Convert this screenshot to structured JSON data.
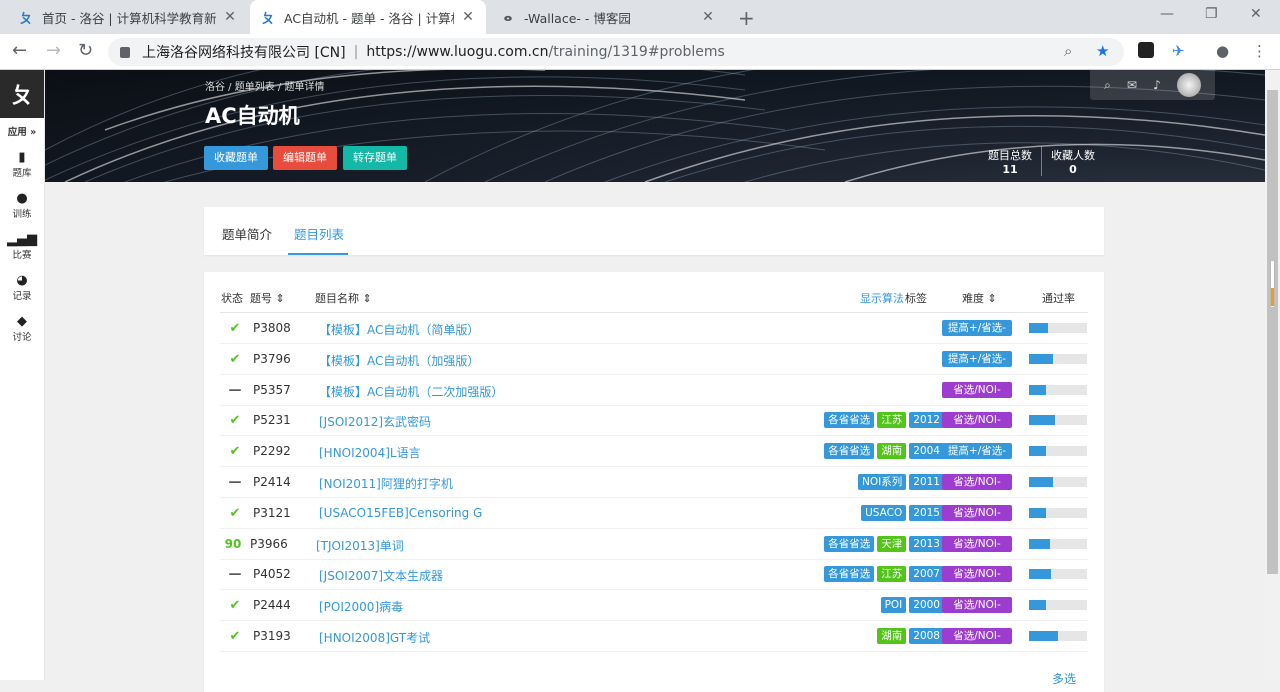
{
  "browser": {
    "tabs": [
      {
        "title": "首页 - 洛谷 | 计算机科学教育新生态",
        "icon": "luogu-icon"
      },
      {
        "title": "AC自动机 - 题单 - 洛谷 | 计算机科学教育新生态",
        "icon": "luogu-icon"
      },
      {
        "title": "-Wallace- - 博客园",
        "icon": "cnblogs-icon"
      }
    ],
    "new_tab": "+",
    "address_site": "上海洛谷网络科技有限公司 [CN]",
    "address_sep": "|",
    "address_host": "https://www.luogu.com.cn",
    "address_path": "/training/1319#problems"
  },
  "leftnav": {
    "logo": "ㄆ",
    "apps_label": "应用 »",
    "items": [
      {
        "label": "题库",
        "icon": "book-icon"
      },
      {
        "label": "训练",
        "icon": "lightbulb-icon"
      },
      {
        "label": "比赛",
        "icon": "bar-chart-icon"
      },
      {
        "label": "记录",
        "icon": "pie-chart-icon"
      },
      {
        "label": "讨论",
        "icon": "chat-icon"
      }
    ]
  },
  "banner": {
    "breadcrumb": "洛谷 / 题单列表 / 题单详情",
    "title": "AC自动机",
    "buttons": {
      "favorite": "收藏题单",
      "edit": "编辑题单",
      "save": "转存题单"
    },
    "stats": {
      "total_label": "题目总数",
      "total_value": "11",
      "fav_label": "收藏人数",
      "fav_value": "0"
    }
  },
  "tabs": {
    "intro": "题单简介",
    "list": "题目列表"
  },
  "table": {
    "headers": {
      "status": "状态",
      "pid": "题号 ⇕",
      "name": "题目名称 ⇕",
      "show_algo": "显示算法",
      "tags": "标签",
      "difficulty": "难度 ⇕",
      "pass_rate": "通过率"
    },
    "rows": [
      {
        "status": "✔",
        "pid": "P3808",
        "name": "【模板】AC自动机（简单版）",
        "tags": [],
        "difficulty": "提高+/省选-",
        "pass": 0.32
      },
      {
        "status": "✔",
        "pid": "P3796",
        "name": "【模板】AC自动机（加强版）",
        "tags": [],
        "difficulty": "提高+/省选-",
        "pass": 0.41
      },
      {
        "status": "—",
        "pid": "P5357",
        "name": "【模板】AC自动机（二次加强版）",
        "tags": [],
        "difficulty": "省选/NOI-",
        "pass": 0.29
      },
      {
        "status": "✔",
        "pid": "P5231",
        "name": "[JSOI2012]玄武密码",
        "tags": [
          "各省省选",
          "江苏",
          "2012"
        ],
        "difficulty": "省选/NOI-",
        "pass": 0.44
      },
      {
        "status": "✔",
        "pid": "P2292",
        "name": "[HNOI2004]L语言",
        "tags": [
          "各省省选",
          "湖南",
          "2004"
        ],
        "difficulty": "提高+/省选-",
        "pass": 0.3
      },
      {
        "status": "—",
        "pid": "P2414",
        "name": "[NOI2011]阿狸的打字机",
        "tags": [
          "NOI系列",
          "2011"
        ],
        "difficulty": "省选/NOI-",
        "pass": 0.41
      },
      {
        "status": "✔",
        "pid": "P3121",
        "name": "[USACO15FEB]Censoring G",
        "tags": [
          "USACO",
          "2015"
        ],
        "difficulty": "省选/NOI-",
        "pass": 0.3
      },
      {
        "status": "90",
        "pid": "P3966",
        "name": "[TJOI2013]单词",
        "tags": [
          "各省省选",
          "天津",
          "2013"
        ],
        "difficulty": "省选/NOI-",
        "pass": 0.37
      },
      {
        "status": "—",
        "pid": "P4052",
        "name": "[JSOI2007]文本生成器",
        "tags": [
          "各省省选",
          "江苏",
          "2007"
        ],
        "difficulty": "省选/NOI-",
        "pass": 0.38
      },
      {
        "status": "✔",
        "pid": "P2444",
        "name": "[POI2000]病毒",
        "tags": [
          "POI",
          "2000"
        ],
        "difficulty": "省选/NOI-",
        "pass": 0.3
      },
      {
        "status": "✔",
        "pid": "P3193",
        "name": "[HNOI2008]GT考试",
        "tags": [
          "湖南",
          "2008"
        ],
        "difficulty": "省选/NOI-",
        "pass": 0.5
      }
    ],
    "more": "多选"
  },
  "colors": {
    "blue": "#3498db",
    "red": "#e74c3c",
    "teal": "#14b8a6",
    "green": "#52c41a",
    "purple": "#9d3dcf",
    "region": "#52c41a",
    "diff_high": "#3498db"
  }
}
